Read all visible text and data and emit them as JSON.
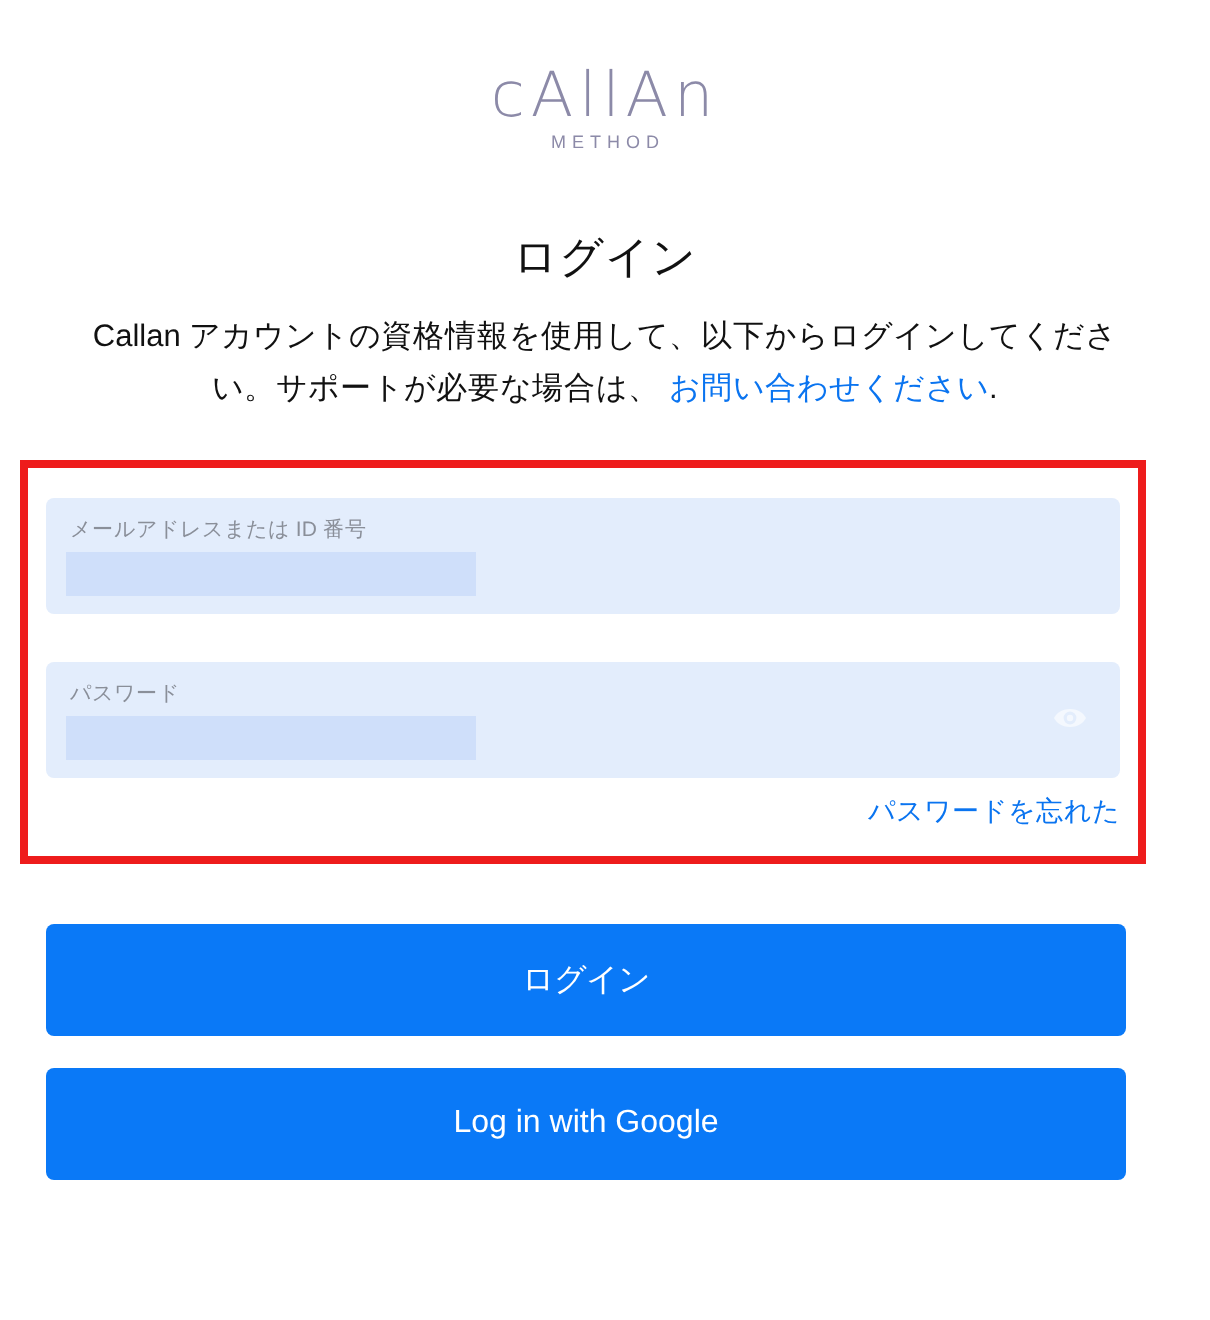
{
  "logo": {
    "wordmark": "cAllAn",
    "tagline": "METHOD"
  },
  "title": "ログイン",
  "intro": {
    "text": "Callan アカウントの資格情報を使用して、以下からログインしてください。サポートが必要な場合は、 ",
    "link": "お問い合わせください",
    "end": "."
  },
  "fields": [
    {
      "kind": "text",
      "label": "メールアドレスまたは ID 番号"
    },
    {
      "kind": "password",
      "label": "パスワード"
    }
  ],
  "forgot_link": "パスワードを忘れた",
  "buttons": [
    "ログイン",
    "Log in with Google"
  ]
}
